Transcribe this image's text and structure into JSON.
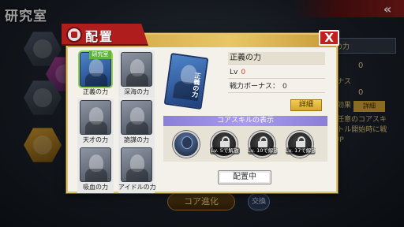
{
  "background": {
    "screen_title": "研究室",
    "right_panel": {
      "header_text": "の力",
      "value_1": "0",
      "label_bonus": "ーナス",
      "value_2": "0",
      "label_effect": "ル効果",
      "detail_label": "詳細",
      "desc_line1": "の任意のコアスキ",
      "desc_line2": "バトル開始時に戦",
      "desc_line3": "pUP"
    },
    "bottom_button": "コア進化",
    "bottom_button2": "交換"
  },
  "dialog": {
    "title": "配置",
    "close_label": "X",
    "cards": [
      {
        "label": "正義の力",
        "tag": "研究室",
        "selected": true
      },
      {
        "label": "深海の力"
      },
      {
        "label": "天才の力"
      },
      {
        "label": "詭謀の力"
      },
      {
        "label": "吸血の力"
      },
      {
        "label": "アイドルの力"
      }
    ],
    "detail": {
      "card_name": "正義の力",
      "art_text": "正義の力",
      "lv_label": "Lv",
      "lv_value": "0",
      "bonus_label": "戦力ボーナス：",
      "bonus_value": "0",
      "detail_button": "詳細"
    },
    "skills": {
      "header": "コアスキルの表示",
      "items": [
        {
          "state": "active",
          "lv_text": ""
        },
        {
          "state": "locked",
          "lv_text": "Lv. 5で解放"
        },
        {
          "state": "locked",
          "lv_text": "Lv. 10で解放"
        },
        {
          "state": "locked",
          "lv_text": "Lv. 17で解放"
        }
      ]
    },
    "deploy_button": "配置中"
  }
}
